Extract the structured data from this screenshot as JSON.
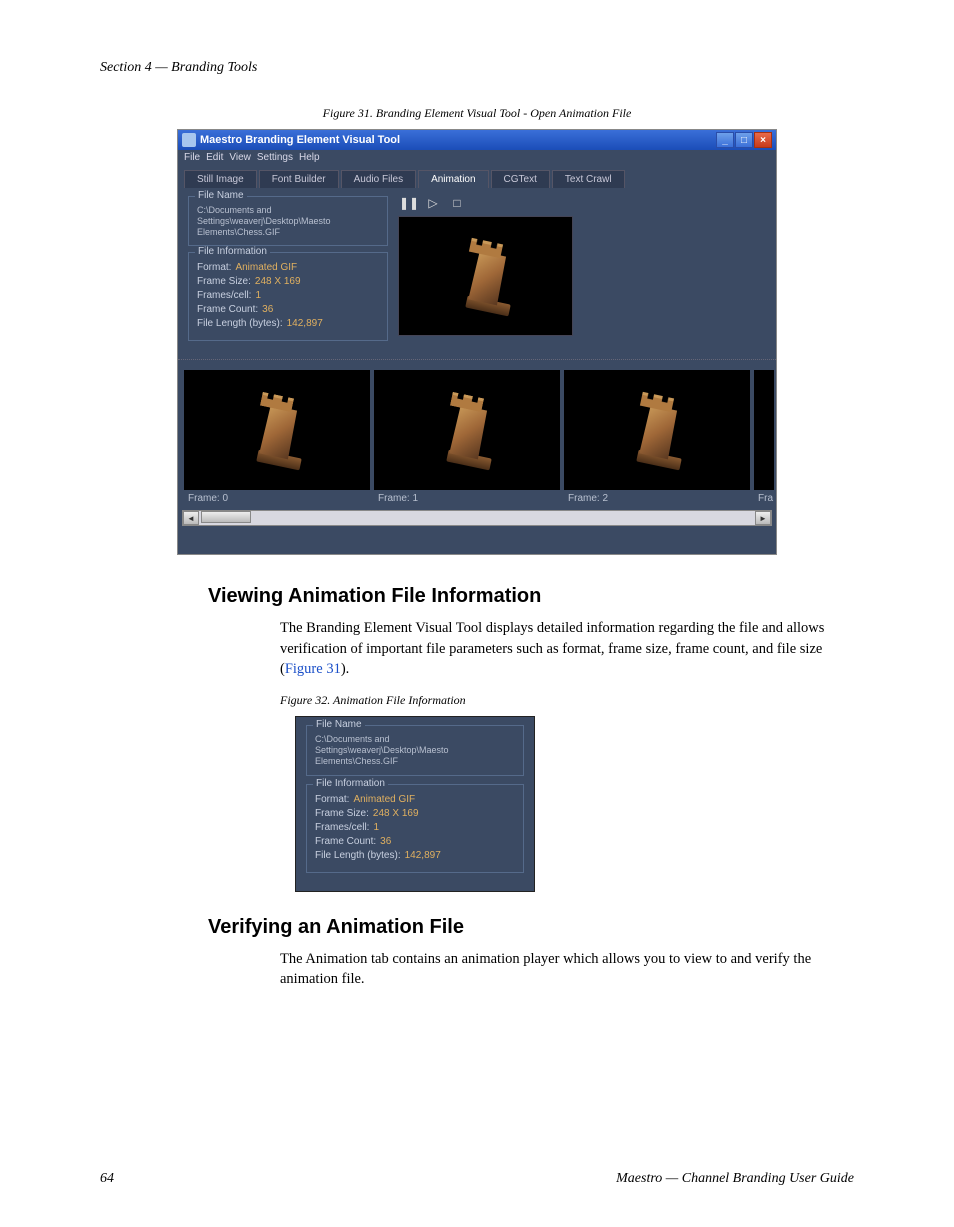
{
  "sectionHeader": "Section 4 — Branding Tools",
  "figure31Caption": "Figure 31.  Branding Element Visual Tool - Open Animation File",
  "figure32Caption": "Figure 32.  Animation File Information",
  "window": {
    "title": "Maestro Branding Element Visual Tool",
    "menus": [
      "File",
      "Edit",
      "View",
      "Settings",
      "Help"
    ],
    "tabs": [
      "Still Image",
      "Font Builder",
      "Audio Files",
      "Animation",
      "CGText",
      "Text Crawl"
    ],
    "activeTab": "Animation",
    "fileNameGroup": "File Name",
    "filePath": "C:\\Documents and Settings\\weaverj\\Desktop\\Maesto Elements\\Chess.GIF",
    "fileInfoGroup": "File Information",
    "info": {
      "formatLabel": "Format:",
      "formatVal": "Animated GIF",
      "frameSizeLabel": "Frame Size:",
      "frameSizeVal": "248 X 169",
      "framesCellLabel": "Frames/cell:",
      "framesCellVal": "1",
      "frameCountLabel": "Frame Count:",
      "frameCountVal": "36",
      "fileLenLabel": "File Length (bytes):",
      "fileLenVal": "142,897"
    },
    "thumbs": [
      "Frame: 0",
      "Frame: 1",
      "Frame: 2",
      "Fra"
    ]
  },
  "heading1": "Viewing Animation File Information",
  "para1a": "The Branding Element Visual Tool displays detailed information regarding the file and allows verification of important file parameters such as format, frame size, frame count, and file size (",
  "para1Link": "Figure 31",
  "para1b": ").",
  "heading2": "Verifying an Animation File",
  "para2": "The Animation tab contains an animation player which allows you to view to and verify the animation file.",
  "footerPage": "64",
  "footerTitle": "Maestro  —  Channel Branding User Guide"
}
